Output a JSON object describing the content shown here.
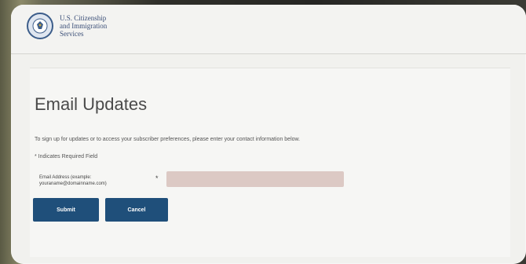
{
  "header": {
    "agency_line1": "U.S. Citizenship",
    "agency_line2": "and Immigration",
    "agency_line3": "Services",
    "logo_icon": "dhs-seal-icon"
  },
  "main": {
    "title": "Email Updates",
    "instructions": "To sign up for updates or to access your subscriber preferences, please enter your contact information below.",
    "required_note": "* Indicates Required Field",
    "email_label": "Email Address (example: youraname@domainname.com)",
    "required_marker": "*",
    "email_value": "",
    "submit_label": "Submit",
    "cancel_label": "Cancel"
  },
  "colors": {
    "button": "#1f4f7a",
    "input_bg": "#dcc9c4",
    "agency_text": "#3b4f78"
  }
}
